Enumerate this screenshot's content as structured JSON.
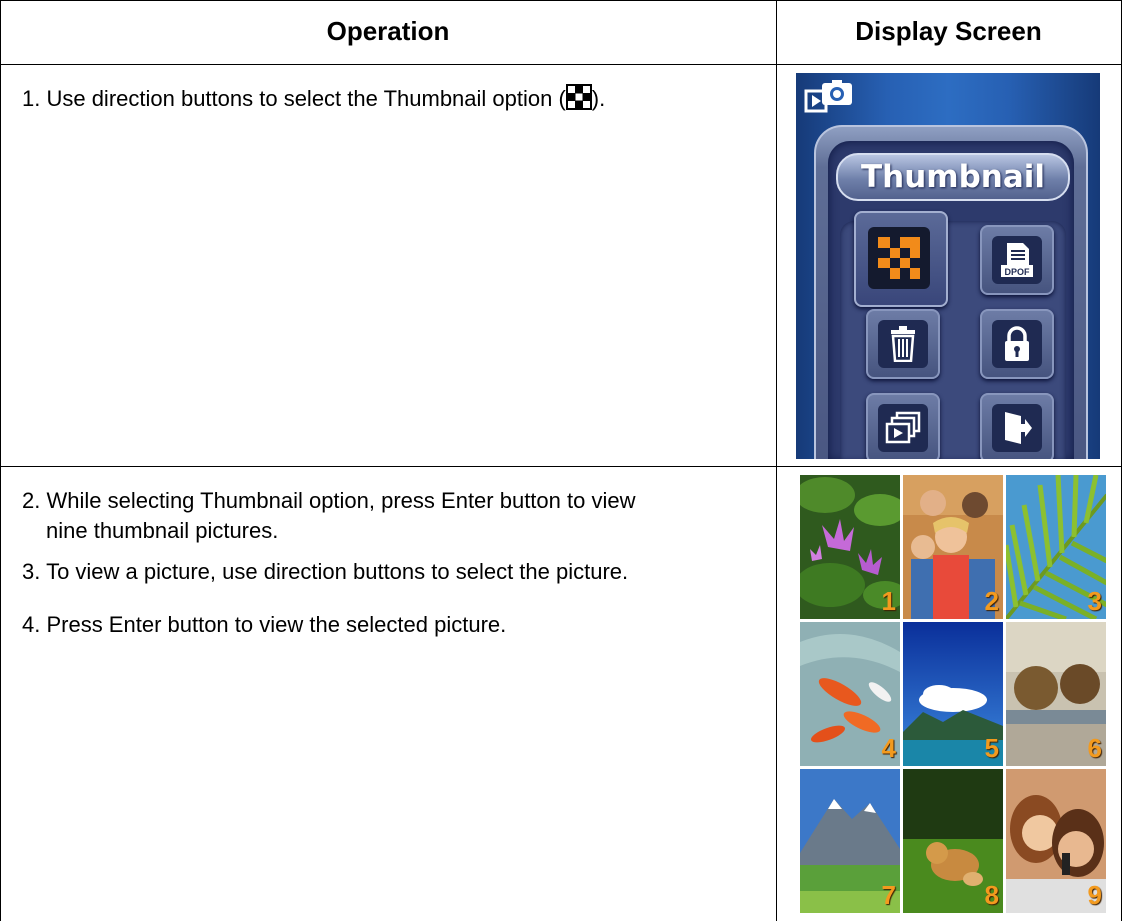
{
  "table": {
    "headers": {
      "operation": "Operation",
      "display": "Display Screen"
    },
    "rows": [
      {
        "steps": [
          {
            "text_before_icon": "1. Use direction buttons to select the Thumbnail option (",
            "text_after_icon": ")."
          }
        ]
      },
      {
        "steps": [
          {
            "line1": "2. While selecting Thumbnail option, press Enter button to view",
            "line2": "nine thumbnail pictures."
          },
          {
            "text": "3. To view a picture, use direction buttons to select the picture."
          },
          {
            "text": "4. Press Enter button to view the selected picture."
          }
        ]
      }
    ]
  },
  "screen1": {
    "title": "Thumbnail",
    "menu_icons": [
      "thumbnail-icon",
      "dpof-icon",
      "delete-icon",
      "lock-icon",
      "slideshow-icon",
      "exit-icon"
    ],
    "dpof_label": "DPOF",
    "selected": "thumbnail-icon"
  },
  "screen2": {
    "thumb_numbers": [
      "1",
      "2",
      "3",
      "4",
      "5",
      "6",
      "7",
      "8",
      "9"
    ],
    "number_color": "#f39a1e"
  }
}
